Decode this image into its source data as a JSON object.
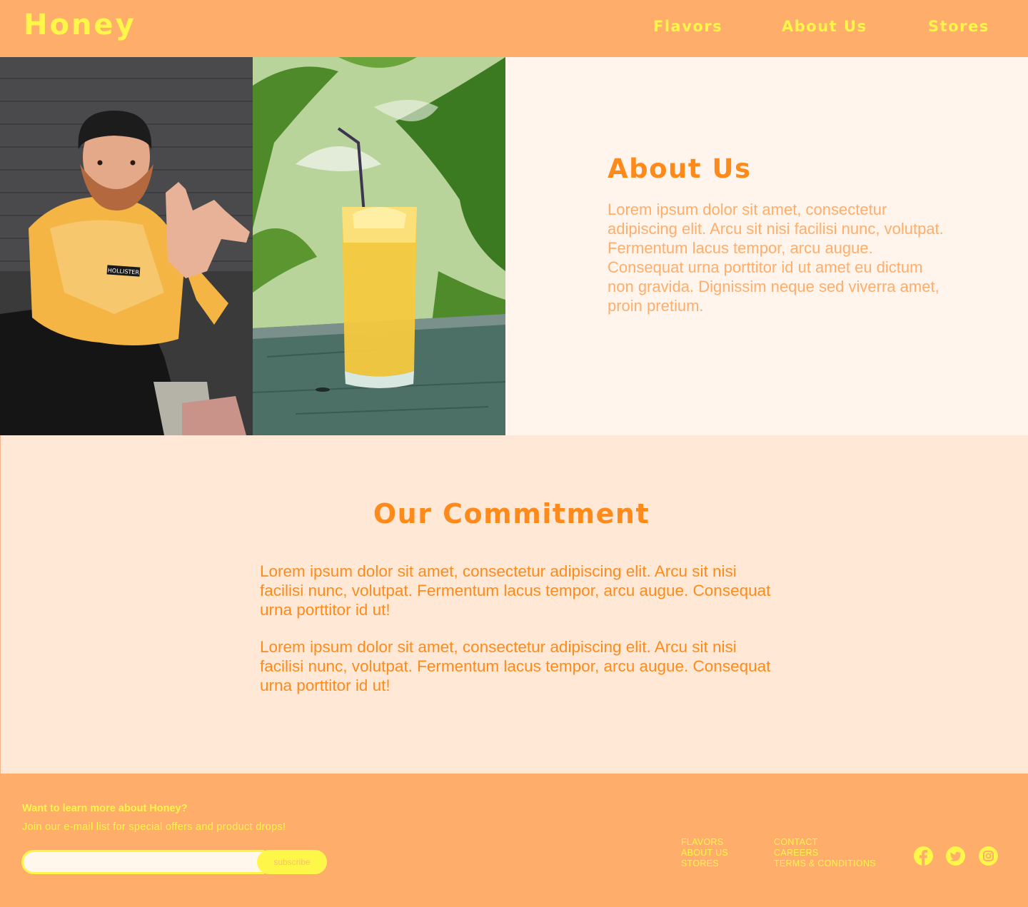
{
  "header": {
    "logo": "Honey",
    "nav": [
      {
        "label": "Flavors"
      },
      {
        "label": "About Us"
      },
      {
        "label": "Stores"
      }
    ]
  },
  "about": {
    "title": "About Us",
    "body": "Lorem ipsum dolor sit amet, consectetur adipiscing elit. Arcu sit nisi facilisi nunc, volutpat. Fermentum lacus tempor, arcu augue. Consequat urna porttitor id ut amet eu dictum non gravida. Dignissim neque sed viverra amet, proin pretium.",
    "shirt_label": "HOLLISTER"
  },
  "commitment": {
    "title": "Our Commitment",
    "paragraphs": [
      "Lorem ipsum dolor sit amet, consectetur adipiscing elit. Arcu sit nisi facilisi nunc, volutpat. Fermentum lacus tempor, arcu augue. Consequat urna porttitor id ut!",
      "Lorem ipsum dolor sit amet, consectetur adipiscing elit. Arcu sit nisi facilisi nunc, volutpat. Fermentum lacus tempor, arcu augue. Consequat urna porttitor id ut!"
    ]
  },
  "footer": {
    "question": "Want to learn more about Honey?",
    "subtitle": "Join our e-mail list for special offers and product drops!",
    "email_value": "",
    "email_placeholder": "",
    "subscribe_label": "subscribe",
    "links_col1": [
      "FLAVORS",
      "ABOUT US",
      "STORES"
    ],
    "links_col2": [
      "CONTACT",
      "CAREERS",
      "TERMS & CONDITIONS"
    ],
    "social": [
      {
        "icon": "facebook-icon"
      },
      {
        "icon": "twitter-icon"
      },
      {
        "icon": "instagram-icon"
      }
    ]
  },
  "colors": {
    "brand_orange": "#ffad6b",
    "accent_yellow": "#fff64a",
    "title_orange": "#ff8a1c",
    "hero_bg": "#fff5ec",
    "commit_bg": "#ffe9d6"
  }
}
